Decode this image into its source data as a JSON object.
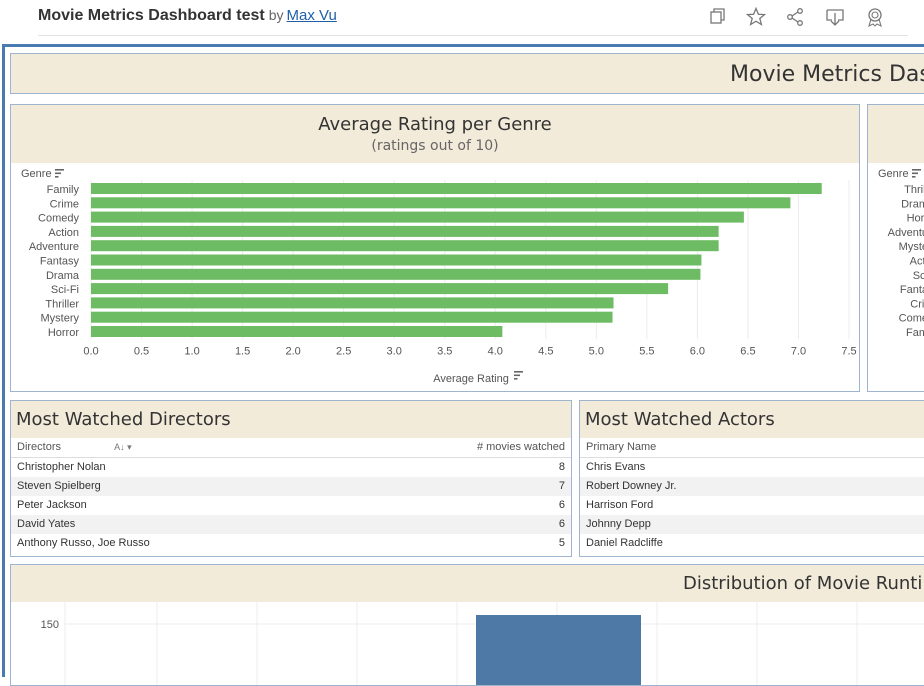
{
  "header": {
    "title": "Movie Metrics Dashboard test",
    "by": "by",
    "author": "Max Vu",
    "icons": [
      "copy-icon",
      "star-icon",
      "share-icon",
      "download-icon",
      "badge-icon"
    ]
  },
  "dashboard": {
    "banner_title": "Movie Metrics Dash"
  },
  "genre_chart": {
    "title": "Average Rating per Genre",
    "subtitle": "(ratings out of 10)",
    "axis_header": "Genre",
    "xlabel": "Average Rating"
  },
  "chart_data": [
    {
      "type": "bar",
      "orientation": "horizontal",
      "title": "Average Rating per Genre",
      "subtitle": "(ratings out of 10)",
      "ylabel": "Genre",
      "xlabel": "Average Rating",
      "xlim": [
        0,
        7.5
      ],
      "xticks": [
        "0.0",
        "0.5",
        "1.0",
        "1.5",
        "2.0",
        "2.5",
        "3.0",
        "3.5",
        "4.0",
        "4.5",
        "5.0",
        "5.5",
        "6.0",
        "6.5",
        "7.0",
        "7.5"
      ],
      "categories": [
        "Family",
        "Crime",
        "Comedy",
        "Action",
        "Adventure",
        "Fantasy",
        "Drama",
        "Sci-Fi",
        "Thriller",
        "Mystery",
        "Horror"
      ],
      "values": [
        7.23,
        6.92,
        6.46,
        6.21,
        6.21,
        6.04,
        6.03,
        5.71,
        5.17,
        5.16,
        4.07
      ],
      "color": "#6dbb63",
      "grid": true
    }
  ],
  "right_chart": {
    "axis_header": "Genre",
    "categories": [
      "Thrill",
      "Dram",
      "Horr",
      "Adventu",
      "Myste",
      "Acti",
      "Sci",
      "Fanta",
      "Crir",
      "Come",
      "Fam"
    ]
  },
  "directors": {
    "title": "Most Watched Directors",
    "col1": "Directors",
    "col2": "# movies watched",
    "rows": [
      {
        "name": "Christopher Nolan",
        "count": "8"
      },
      {
        "name": "Steven Spielberg",
        "count": "7"
      },
      {
        "name": "Peter Jackson",
        "count": "6"
      },
      {
        "name": "David Yates",
        "count": "6"
      },
      {
        "name": "Anthony Russo, Joe Russo",
        "count": "5"
      }
    ]
  },
  "actors": {
    "title": "Most Watched Actors",
    "col1": "Primary Name",
    "rows": [
      "Chris Evans",
      "Robert Downey Jr.",
      "Harrison Ford",
      "Johnny Depp",
      "Daniel Radcliffe"
    ]
  },
  "runtime": {
    "title": "Distribution of Movie Runtim",
    "ytick": "150",
    "bar_color": "#4e79a7"
  }
}
